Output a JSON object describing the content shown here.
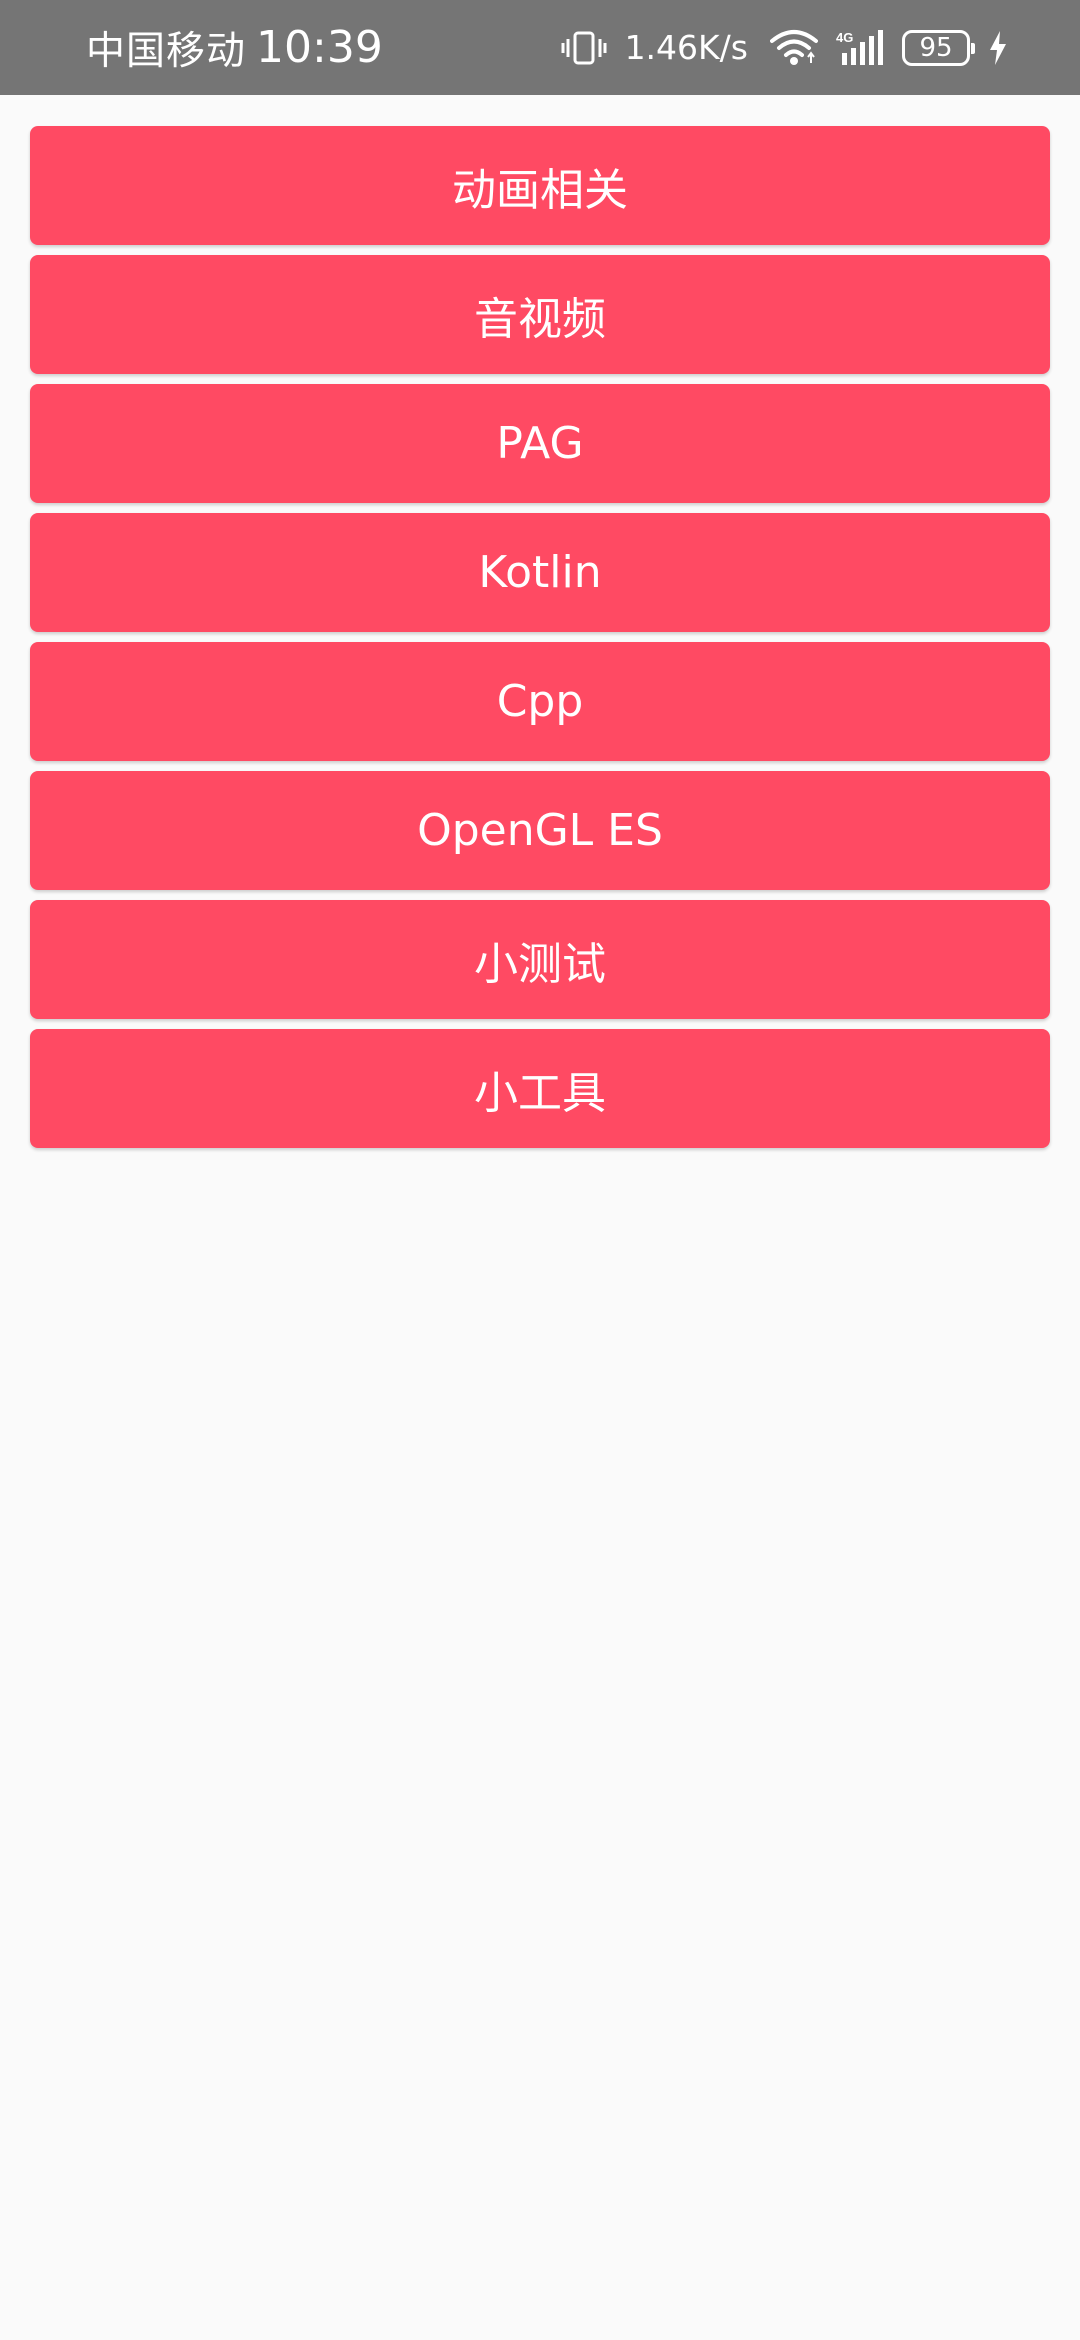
{
  "status_bar": {
    "carrier": "中国移动",
    "time": "10:39",
    "net_speed": "1.46K/s",
    "network_type": "4G",
    "battery_level": "95",
    "icons": [
      "vibrate-icon",
      "wifi-icon",
      "cellular-signal-icon",
      "battery-icon",
      "charging-icon"
    ]
  },
  "menu": {
    "items": [
      {
        "label": "动画相关"
      },
      {
        "label": "音视频"
      },
      {
        "label": "PAG"
      },
      {
        "label": "Kotlin"
      },
      {
        "label": "Cpp"
      },
      {
        "label": "OpenGL ES"
      },
      {
        "label": "小测试"
      },
      {
        "label": "小工具"
      }
    ]
  },
  "colors": {
    "status_bar_bg": "#757575",
    "button_bg": "#ff4a63",
    "page_bg": "#fafafa",
    "text_on_button": "#ffffff"
  }
}
